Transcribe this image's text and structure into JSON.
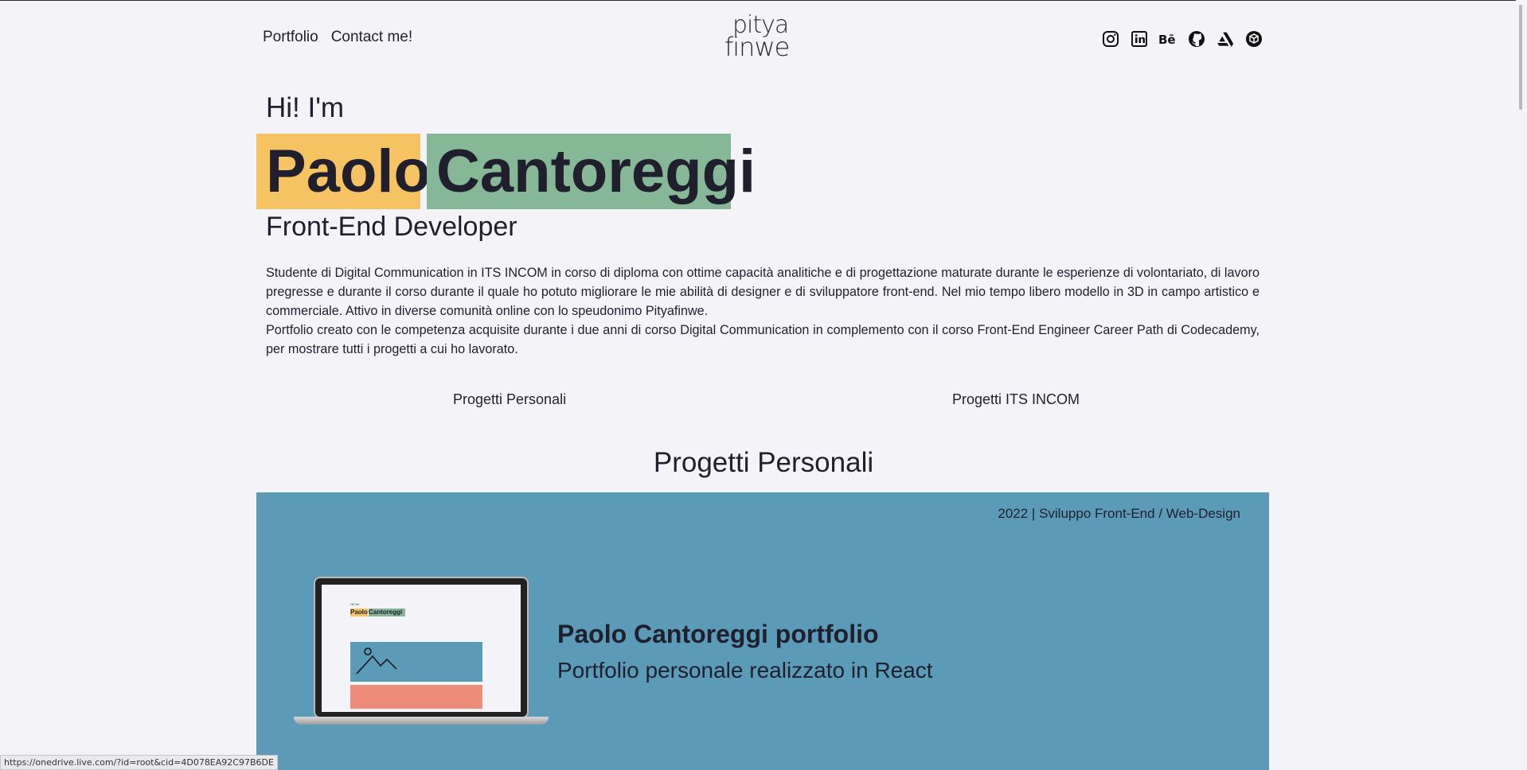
{
  "nav": {
    "portfolio": "Portfolio",
    "contact": "Contact me!"
  },
  "logo": {
    "line1": "pitya",
    "line2": "finwe"
  },
  "socials": [
    "instagram-icon",
    "linkedin-icon",
    "behance-icon",
    "github-icon",
    "artstation-icon",
    "sketchfab-icon"
  ],
  "socials_text": {
    "behance": "Bē"
  },
  "hero": {
    "greeting": "Hi! I'm",
    "first_name": "Paolo",
    "last_name": "Cantoreggi",
    "role": "Front-End Developer",
    "bio_p1": "Studente di Digital Communication in ITS INCOM in corso di diploma con ottime capacità analitiche e di progettazione maturate durante le esperienze di volontariato, di lavoro pregresse e durante il corso durante il quale ho potuto migliorare le mie abilità di designer e di sviluppatore front-end. Nel mio tempo libero modello in 3D in campo artistico e commerciale. Attivo in diverse comunità online con lo speudonimo Pityafinwe.",
    "bio_p2": "Portfolio creato con le competenza acquisite durante i due anni di corso Digital Communication in complemento con il corso Front-End Engineer Career Path di Codecademy, per mostrare tutti i progetti a cui ho lavorato."
  },
  "tabs": {
    "personal": "Progetti Personali",
    "its": "Progetti ITS INCOM"
  },
  "section": {
    "title": "Progetti Personali"
  },
  "project": {
    "meta": "2022 | Sviluppo Front-End / Web-Design",
    "title": "Paolo Cantoreggi portfolio",
    "subtitle": "Portfolio personale realizzato in React"
  },
  "status_url": "https://onedrive.live.com/?id=root&cid=4D078EA92C97B6DE",
  "colors": {
    "background": "#f4f4f8",
    "yellow": "#f6c363",
    "green": "#86b796",
    "card": "#5b9bb7",
    "salmon": "#ee8c7a"
  }
}
